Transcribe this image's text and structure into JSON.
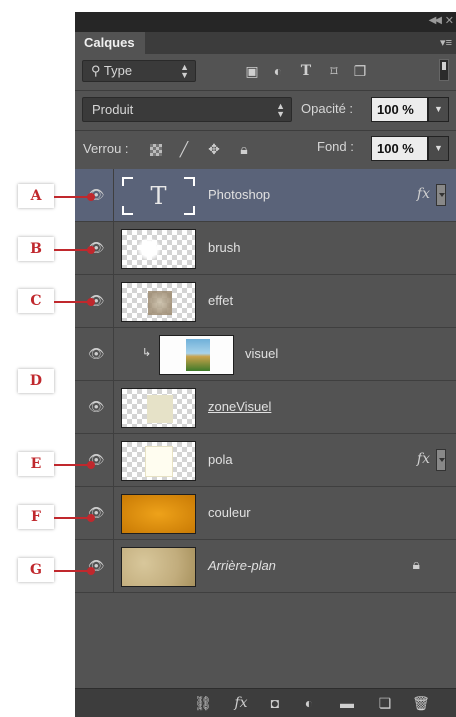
{
  "panel": {
    "tab_label": "Calques",
    "collapse_icon": "double-chevron-left-icon",
    "close_icon": "close-icon",
    "menu_icon": "panel-menu-icon"
  },
  "filter": {
    "kind_label": "Type",
    "icons": [
      "image-filter-icon",
      "adjustment-filter-icon",
      "type-filter-icon",
      "shape-filter-icon",
      "smart-object-filter-icon"
    ]
  },
  "blend": {
    "mode": "Produit",
    "opacity_label": "Opacité :",
    "opacity_value": "100 %"
  },
  "lock": {
    "label": "Verrou :",
    "fill_label": "Fond :",
    "fill_value": "100 %"
  },
  "layers": [
    {
      "name": "Photoshop",
      "selected": true,
      "fx": "fx",
      "thumb": "text"
    },
    {
      "name": "brush",
      "thumb": "brush"
    },
    {
      "name": "effet",
      "thumb": "effet"
    },
    {
      "name": "visuel",
      "thumb": "visuel",
      "clipped": true
    },
    {
      "name": "zoneVisuel",
      "thumb": "zone"
    },
    {
      "name": "pola",
      "fx": "fx",
      "thumb": "pola"
    },
    {
      "name": "couleur",
      "thumb": "couleur"
    },
    {
      "name": "Arrière-plan",
      "thumb": "bg",
      "locked": true
    }
  ],
  "thumb_text_glyph": "T",
  "fx_label": "fx",
  "bottom_icons": [
    "link-layers-icon",
    "fx-icon",
    "layer-mask-icon",
    "adjustment-layer-icon",
    "group-folder-icon",
    "new-layer-icon",
    "trash-icon"
  ],
  "callouts": [
    "A",
    "B",
    "C",
    "D",
    "E",
    "F",
    "G"
  ],
  "colors": {
    "panel_bg": "#535353",
    "selected_layer": "#5a6379",
    "callout_red": "#c0282d",
    "couleur_fill": "#d68a06"
  }
}
